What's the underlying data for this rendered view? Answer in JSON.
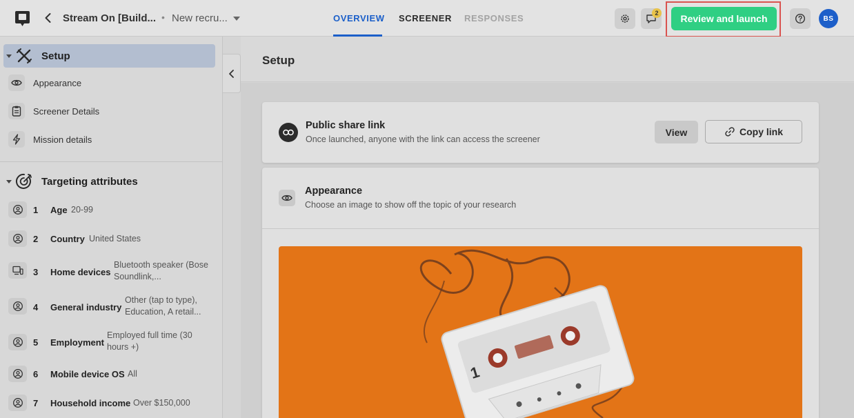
{
  "header": {
    "project_title": "Stream On [Build...",
    "separator": "•",
    "project_subtitle": "New recru...",
    "tabs": [
      {
        "label": "OVERVIEW"
      },
      {
        "label": "SCREENER"
      },
      {
        "label": "RESPONSES"
      }
    ],
    "notification_count": "2",
    "launch_label": "Review and launch",
    "avatar_initials": "BS"
  },
  "sidebar": {
    "setup_title": "Setup",
    "setup_items": [
      {
        "label": "Appearance",
        "icon": "eye-icon"
      },
      {
        "label": "Screener Details",
        "icon": "clipboard-icon"
      },
      {
        "label": "Mission details",
        "icon": "lightning-icon"
      }
    ],
    "targeting_title": "Targeting attributes",
    "attributes": [
      {
        "num": "1",
        "name": "Age",
        "value": "20-99"
      },
      {
        "num": "2",
        "name": "Country",
        "value": "United States"
      },
      {
        "num": "3",
        "name": "Home devices",
        "value": "Bluetooth speaker (Bose Soundlink,..."
      },
      {
        "num": "4",
        "name": "General industry",
        "value": "Other (tap to type), Education, A retail..."
      },
      {
        "num": "5",
        "name": "Employment",
        "value": "Employed full time (30 hours +)"
      },
      {
        "num": "6",
        "name": "Mobile device OS",
        "value": "All"
      },
      {
        "num": "7",
        "name": "Household income",
        "value": "Over $150,000"
      }
    ]
  },
  "main": {
    "page_title": "Setup",
    "share": {
      "title": "Public share link",
      "description": "Once launched, anyone with the link can access the screener",
      "view_label": "View",
      "copy_label": "Copy link"
    },
    "appearance": {
      "title": "Appearance",
      "description": "Choose an image to show off the topic of your research"
    }
  },
  "colors": {
    "accent_blue": "#1b5fc9",
    "launch_green": "#2fcf83",
    "cover_orange": "#e37417",
    "highlight_red": "#d9534f"
  }
}
